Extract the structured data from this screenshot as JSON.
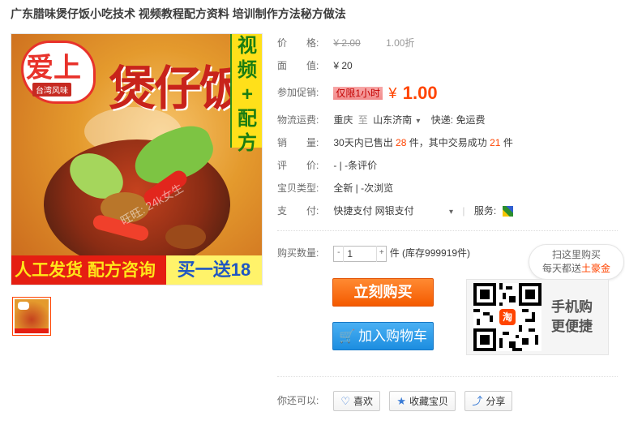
{
  "title": "广东腊味煲仔饭小吃技术 视频教程配方资料 培训制作方法秘方做法",
  "image": {
    "logo_text": "爱上",
    "logo_sub": "台湾风味",
    "big_title": "煲仔饭",
    "vertical_text": [
      "视",
      "频",
      "+",
      "配",
      "方"
    ],
    "watermark": "旺旺: 24k女生",
    "banner_left": "人工发货  配方咨询",
    "banner_right": "买一送18"
  },
  "price": {
    "label": "价　　格:",
    "original": "¥ 2.00",
    "discount": "1.00折"
  },
  "face_value": {
    "label": "面　　值:",
    "value": "¥ 20"
  },
  "promo": {
    "label": "参加促销:",
    "tag": "仅限1小时",
    "yen": "¥",
    "price": "1.00"
  },
  "shipping": {
    "label": "物流运费:",
    "from": "重庆",
    "sep": "至",
    "to": "山东济南",
    "arrow": "▾",
    "method": "快递: 免运费"
  },
  "sales": {
    "label": "销　　量:",
    "prefix": "30天内已售出",
    "sold": "28",
    "mid": "件，其中交易成功",
    "success": "21",
    "suffix": "件"
  },
  "review": {
    "label": "评　　价:",
    "value": "-  |  -条评价"
  },
  "type": {
    "label": "宝贝类型:",
    "value": "全新  |  -次浏览"
  },
  "payment": {
    "label": "支　　付:",
    "methods": "快捷支付   网银支付",
    "arrow": "▾",
    "service_label": "服务:"
  },
  "quantity": {
    "label": "购买数量:",
    "value": "1",
    "minus": "-",
    "plus": "+",
    "stock": "件 (库存999919件)"
  },
  "buttons": {
    "buy": "立刻购买",
    "cart_icon": "🛒",
    "cart": "加入购物车"
  },
  "promo_bubble": {
    "line1": "扫这里购买",
    "line2_prefix": "每天都送",
    "line2_gold": "土豪金"
  },
  "qr": {
    "center": "淘",
    "text_line1": "手机购",
    "text_line2": "更便捷"
  },
  "share": {
    "label": "你还可以:",
    "like_icon": "♡",
    "like": "喜欢",
    "fav_icon": "★",
    "fav": "收藏宝贝",
    "share_icon": "⤴",
    "share": "分享"
  },
  "colors": {
    "accent": "#ff4400",
    "buy_orange": "#f45a00",
    "cart_blue": "#1c8de0"
  }
}
